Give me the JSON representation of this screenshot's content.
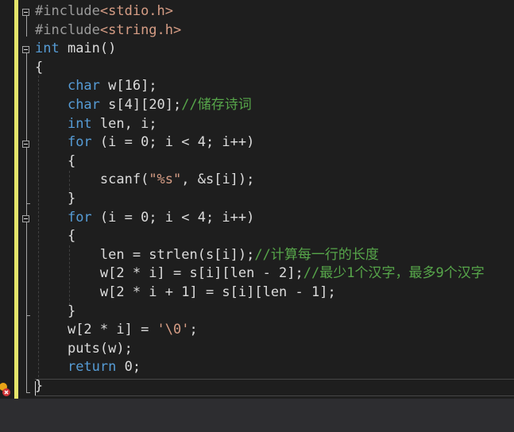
{
  "editor": {
    "language": "C",
    "colors": {
      "background": "#1e1e1e",
      "keyword": "#569cd6",
      "preprocessor": "#9b9b9b",
      "include_path": "#d69d85",
      "string": "#d69d85",
      "comment": "#57a64a",
      "text": "#dcdcdc",
      "change_bar": "#e5e56b"
    },
    "lines": {
      "l1": {
        "pp": "#include",
        "inc": "<stdio.h>"
      },
      "l2": {
        "pp": "#include",
        "inc": "<string.h>"
      },
      "l3": {
        "kw": "int",
        "rest": " main()"
      },
      "l4": {
        "text": "{"
      },
      "l5": {
        "kw": "char",
        "rest": " w[16];"
      },
      "l6": {
        "kw": "char",
        "rest": " s[4][20];",
        "cmt": "//储存诗词"
      },
      "l7": {
        "kw": "int",
        "rest": " len, i;"
      },
      "l8": {
        "kw": "for",
        "rest": " (i = 0; i < 4; i++)"
      },
      "l9": {
        "text": "{"
      },
      "l10": {
        "pre": "scanf(",
        "str": "\"%s\"",
        "rest": ", &s[i]);"
      },
      "l11": {
        "text": "}"
      },
      "l12": {
        "kw": "for",
        "rest": " (i = 0; i < 4; i++)"
      },
      "l13": {
        "text": "{"
      },
      "l14": {
        "text": "len = strlen(s[i]);",
        "cmt": "//计算每一行的长度"
      },
      "l15": {
        "text": "w[2 * i] = s[i][len - 2];",
        "cmt": "//最少1个汉字，最多9个汉字"
      },
      "l16": {
        "text": "w[2 * i + 1] = s[i][len - 1];"
      },
      "l17": {
        "text": "}"
      },
      "l18": {
        "pre": "w[2 * i] = ",
        "str": "'\\0'",
        "rest": ";"
      },
      "l19": {
        "text": "puts(w);"
      },
      "l20": {
        "kw": "return",
        "rest": " 0;"
      },
      "l21": {
        "text": "}"
      }
    }
  },
  "icons": {
    "fold_toggle": "minus-box-icon",
    "error_marker": "error-icon"
  }
}
